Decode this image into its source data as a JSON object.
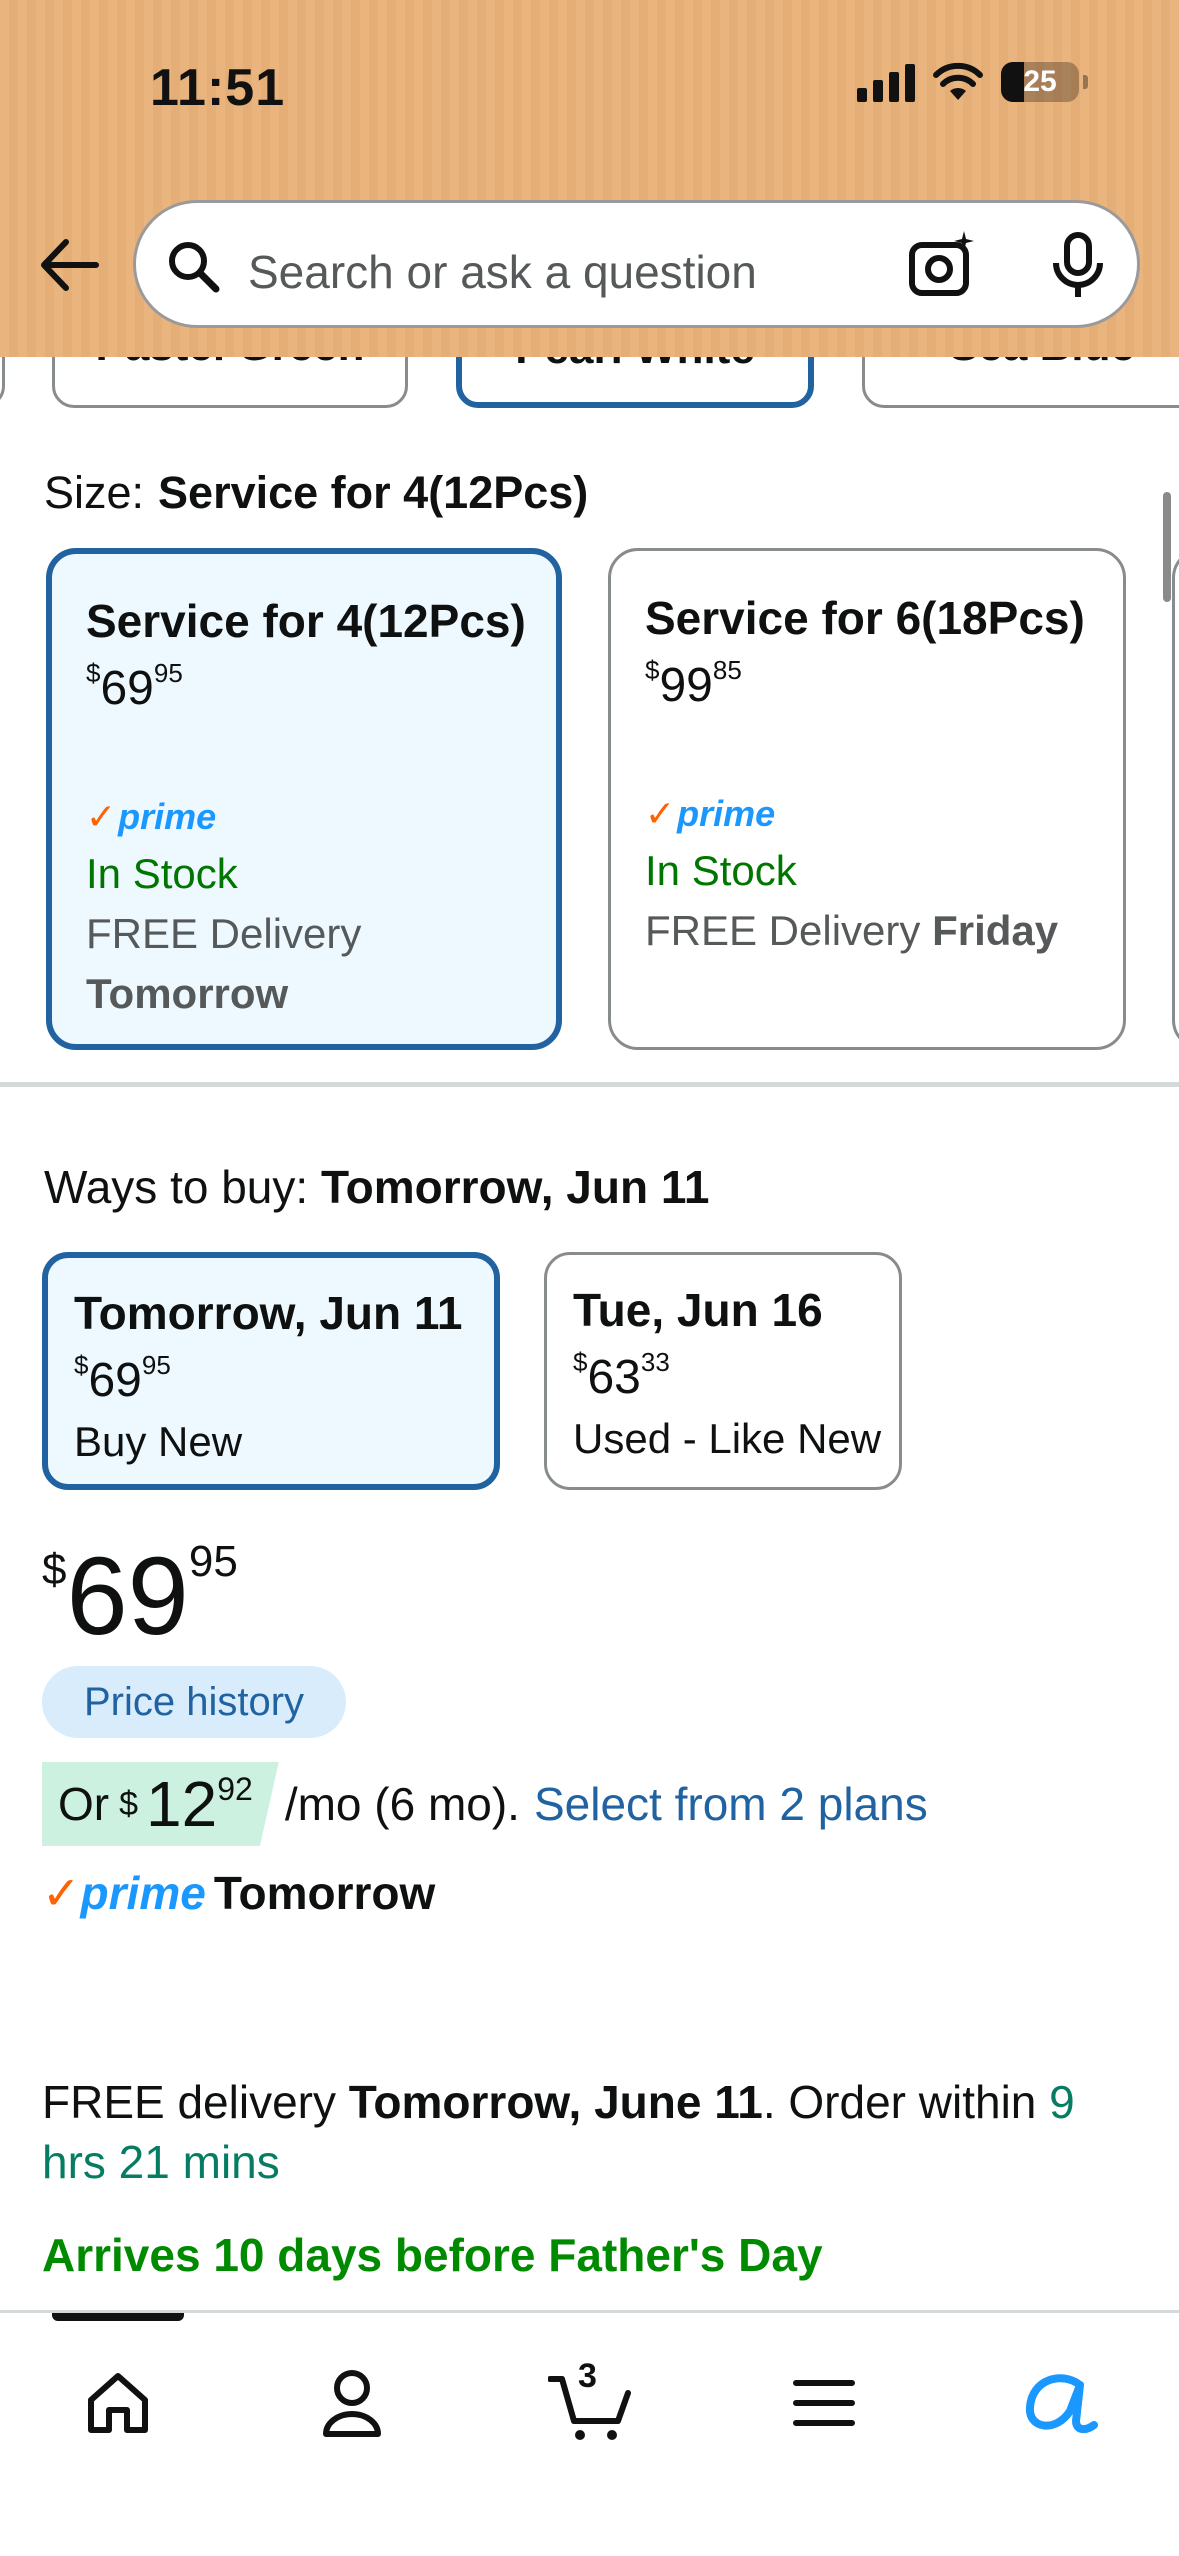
{
  "status_bar": {
    "time": "11:51",
    "battery": "25"
  },
  "header": {
    "search_placeholder": "Search or ask a question"
  },
  "color_chips": [
    {
      "label": "Pastel Green"
    },
    {
      "label": "Pearl White"
    },
    {
      "label": "Sea Blue"
    }
  ],
  "size": {
    "label": "Size:",
    "selected": "Service for 4(12Pcs)",
    "options": [
      {
        "title": "Service for 4(12Pcs)",
        "price_whole": "69",
        "price_frac": "95",
        "prime": "prime",
        "stock": "In Stock",
        "delivery_prefix": "FREE Delivery",
        "delivery_day": "Tomorrow"
      },
      {
        "title": "Service for 6(18Pcs)",
        "price_whole": "99",
        "price_frac": "85",
        "prime": "prime",
        "stock": "In Stock",
        "delivery_prefix": "FREE Delivery",
        "delivery_day": "Friday"
      }
    ]
  },
  "ways_to_buy": {
    "label": "Ways to buy:",
    "selected": "Tomorrow, Jun 11",
    "options": [
      {
        "title": "Tomorrow, Jun 11",
        "price_whole": "69",
        "price_frac": "95",
        "condition": "Buy New"
      },
      {
        "title": "Tue, Jun 16",
        "price_whole": "63",
        "price_frac": "33",
        "condition": "Used - Like New"
      }
    ]
  },
  "price": {
    "currency": "$",
    "whole": "69",
    "fraction": "95"
  },
  "price_history_label": "Price history",
  "monthly": {
    "prefix": "Or",
    "currency": "$",
    "whole": "12",
    "fraction": "92",
    "suffix": "/mo (6 mo).",
    "link": "Select from 2 plans"
  },
  "prime_delivery": {
    "logo": "prime",
    "when": "Tomorrow"
  },
  "delivery": {
    "prefix": "FREE delivery",
    "date": "Tomorrow, June 11",
    "order_within": ". Order within",
    "countdown": "9 hrs 21 mins"
  },
  "arrives_note": "Arrives 10 days before Father's Day",
  "bottom_nav": {
    "cart_count": "3"
  },
  "colors": {
    "accent_blue": "#2162a1",
    "prime_blue": "#1a98ff",
    "in_stock_green": "#007600",
    "header_orange": "#e9b47e"
  }
}
